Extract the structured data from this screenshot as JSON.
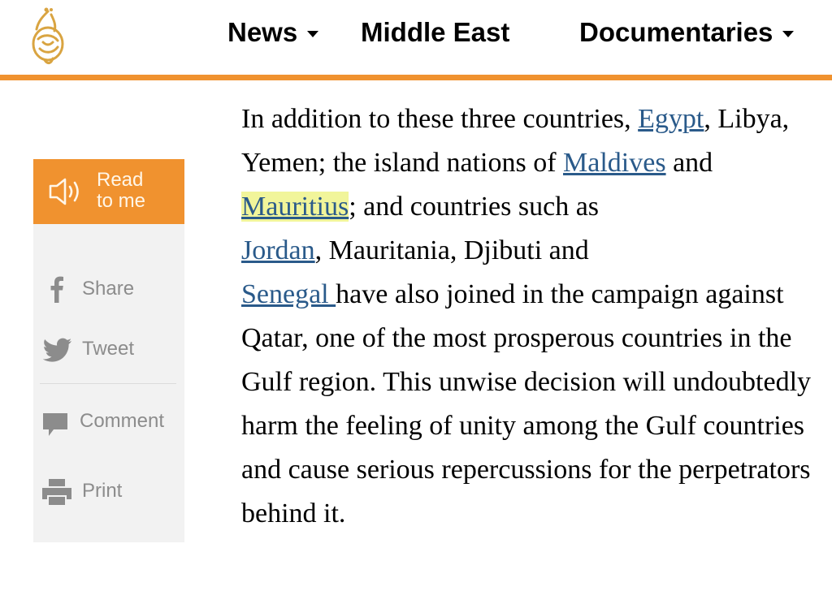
{
  "colors": {
    "accent": "#f0922f",
    "link": "#2a5a8a",
    "highlight": "#f1f59a",
    "sidebar_bg": "#f2f2f2",
    "sidebar_text": "#8c8c8c"
  },
  "header": {
    "logo_icon": "al-jazeera-logo-icon",
    "nav": [
      {
        "label": "News",
        "has_dropdown": true
      },
      {
        "label": "Middle East",
        "has_dropdown": false
      },
      {
        "label": "Documentaries",
        "has_dropdown": true
      }
    ]
  },
  "sidebar": {
    "read": {
      "icon": "speaker-icon",
      "line1": "Read",
      "line2": "to me"
    },
    "items": [
      {
        "icon": "facebook-icon",
        "label": "Share"
      },
      {
        "icon": "twitter-icon",
        "label": "Tweet"
      },
      {
        "icon": "comment-icon",
        "label": "Comment"
      },
      {
        "icon": "printer-icon",
        "label": "Print"
      }
    ]
  },
  "article": {
    "t1": "In addition to these three countries, ",
    "link_egypt": "Egypt",
    "t2": ", Libya, Yemen; the island nations of ",
    "link_maldives": "Maldives",
    "t3": " and ",
    "link_mauritius": "Mauritius",
    "t4": "; and countries such as ",
    "link_jordan": "Jordan",
    "t5": ", Mauritania, Djibuti and ",
    "link_senegal": "Senegal ",
    "t6": "have also joined in the campaign against Qatar, one of the most prosperous countries in the Gulf region. This unwise decision will undoubtedly harm the feeling of unity among the Gulf countries and cause serious repercussions for the perpetrators behind it."
  }
}
